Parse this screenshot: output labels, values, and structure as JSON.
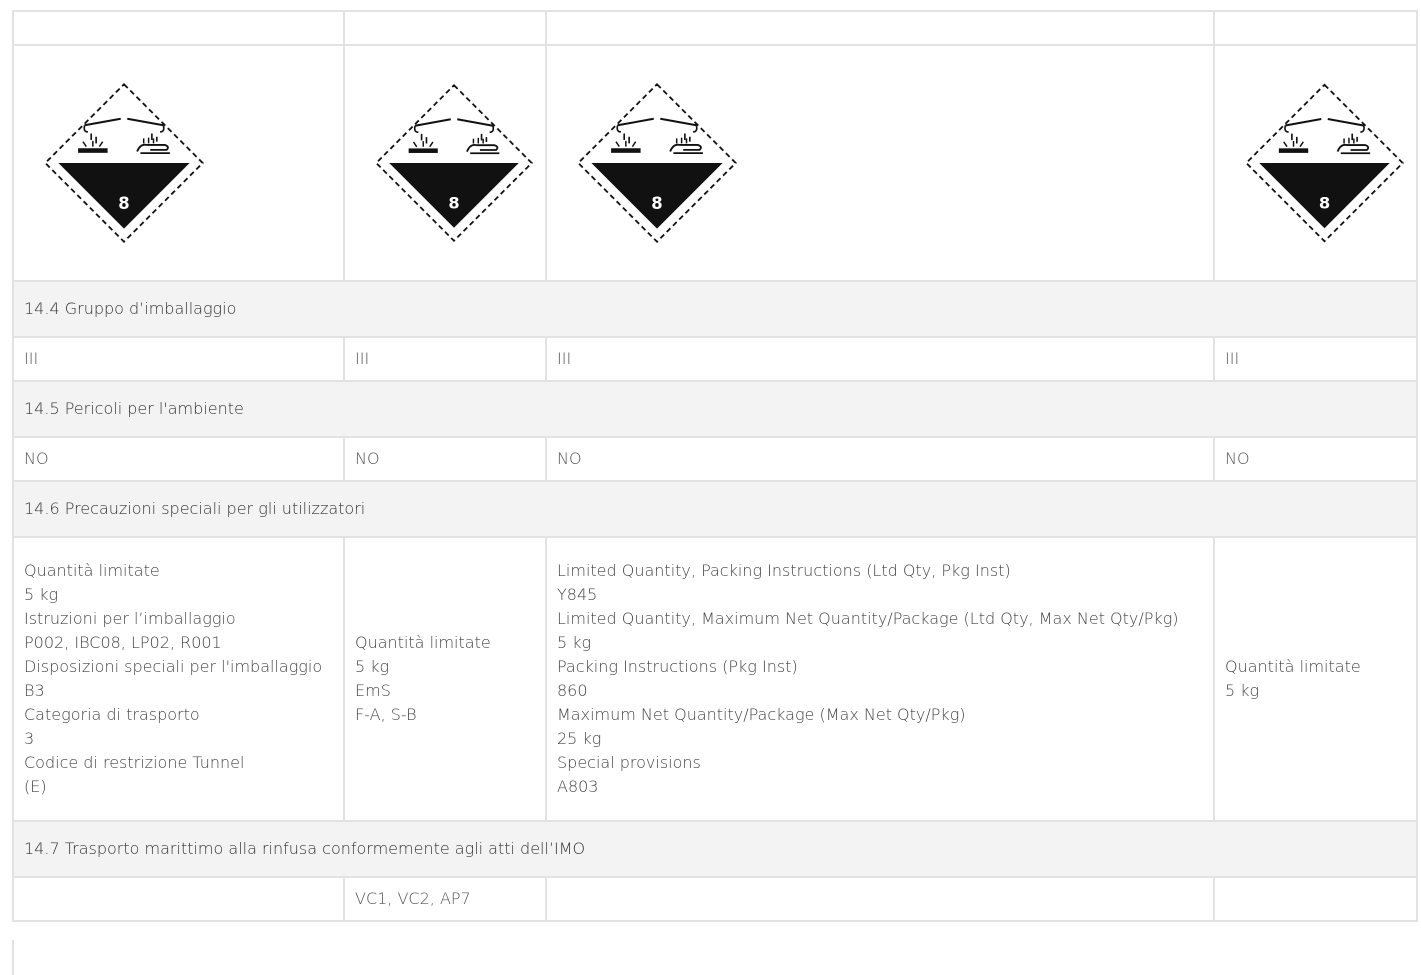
{
  "pictogram": {
    "icon": "corrosive-class-8-diamond-icon",
    "class_number": "8"
  },
  "section_14_4": {
    "heading": "14.4 Gruppo d’imballaggio",
    "values": [
      "III",
      "III",
      "III",
      "III"
    ]
  },
  "section_14_5": {
    "heading": "14.5 Pericoli per l'ambiente",
    "values": [
      "NO",
      "NO",
      "NO",
      "NO"
    ]
  },
  "section_14_6": {
    "heading": "14.6 Precauzioni speciali per gli utilizzatori",
    "col1": [
      "Quantità limitate",
      "5 kg",
      "Istruzioni per l’imballaggio",
      "P002, IBC08, LP02, R001",
      "Disposizioni speciali per l'imballaggio",
      "B3",
      "Categoria di trasporto",
      "3",
      "Codice di restrizione Tunnel",
      "(E)"
    ],
    "col2": [
      "Quantità limitate",
      "5 kg",
      "EmS",
      "F-A, S-B"
    ],
    "col3": [
      "Limited Quantity, Packing Instructions (Ltd Qty, Pkg Inst)",
      "Y845",
      "Limited Quantity, Maximum Net Quantity/Package (Ltd Qty, Max Net Qty/Pkg)",
      "5 kg",
      "Packing Instructions (Pkg Inst)",
      "860",
      "Maximum Net Quantity/Package (Max Net Qty/Pkg)",
      "25 kg",
      "Special provisions",
      "A803"
    ],
    "col4": [
      "Quantità limitate",
      "5 kg"
    ]
  },
  "section_14_7": {
    "heading": "14.7 Trasporto marittimo alla rinfusa conformemente agli atti dell’IMO",
    "values": [
      "",
      "VC1, VC2, AP7",
      "",
      ""
    ]
  }
}
